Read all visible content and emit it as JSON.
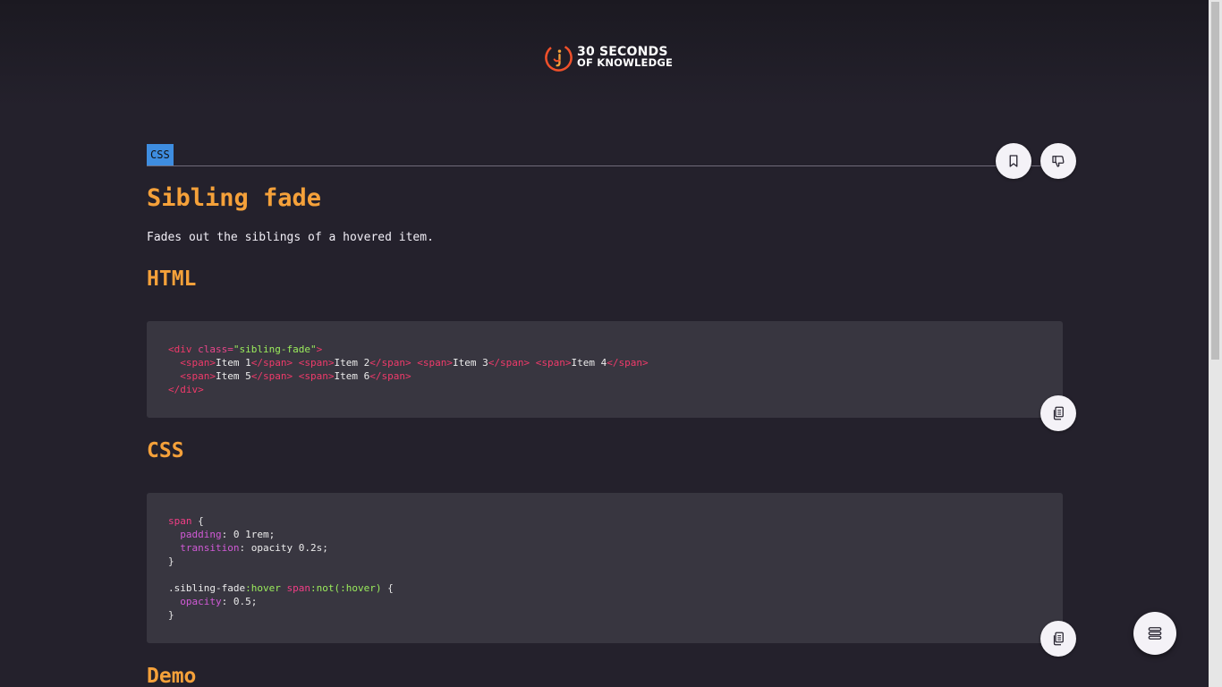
{
  "header": {
    "logo_line1": "30 SECONDS",
    "logo_line2": "OF KNOWLEDGE"
  },
  "article": {
    "tag": "CSS",
    "title": "Sibling fade",
    "description": "Fades out the siblings of a hovered item.",
    "sections": {
      "html_heading": "HTML",
      "css_heading": "CSS",
      "demo_heading": "Demo"
    },
    "html_code": {
      "div_open": "<div",
      "class_attr": " class=",
      "class_value": "\"sibling-fade\"",
      "div_close_bracket": ">",
      "items_row1": [
        "Item 1",
        "Item 2",
        "Item 3",
        "Item 4"
      ],
      "items_row2": [
        "Item 5",
        "Item 6"
      ],
      "span_open": "<span>",
      "span_close": "</span>",
      "div_end": "</div>"
    },
    "css_code": {
      "sel1": "span",
      "brace_open": " {",
      "prop_padding": "padding",
      "val_padding": ": 0 1rem;",
      "prop_transition": "transition",
      "val_transition": ": opacity 0.2s;",
      "brace_close": "}",
      "sel2_class": ".sibling-fade",
      "sel2_pseudo": ":hover",
      "sel2_span": " span",
      "sel2_not": ":not(:hover)",
      "prop_opacity": "opacity",
      "val_opacity": ": 0.5;"
    }
  },
  "colors": {
    "accent": "#f5a13a",
    "tag_bg": "#3e8de0",
    "page_bg": "#24212c",
    "code_bg": "#383640"
  },
  "icons": {
    "bookmark": "bookmark-icon",
    "dislike": "thumbs-down-icon",
    "copy": "copy-icon",
    "menu": "menu-icon"
  }
}
